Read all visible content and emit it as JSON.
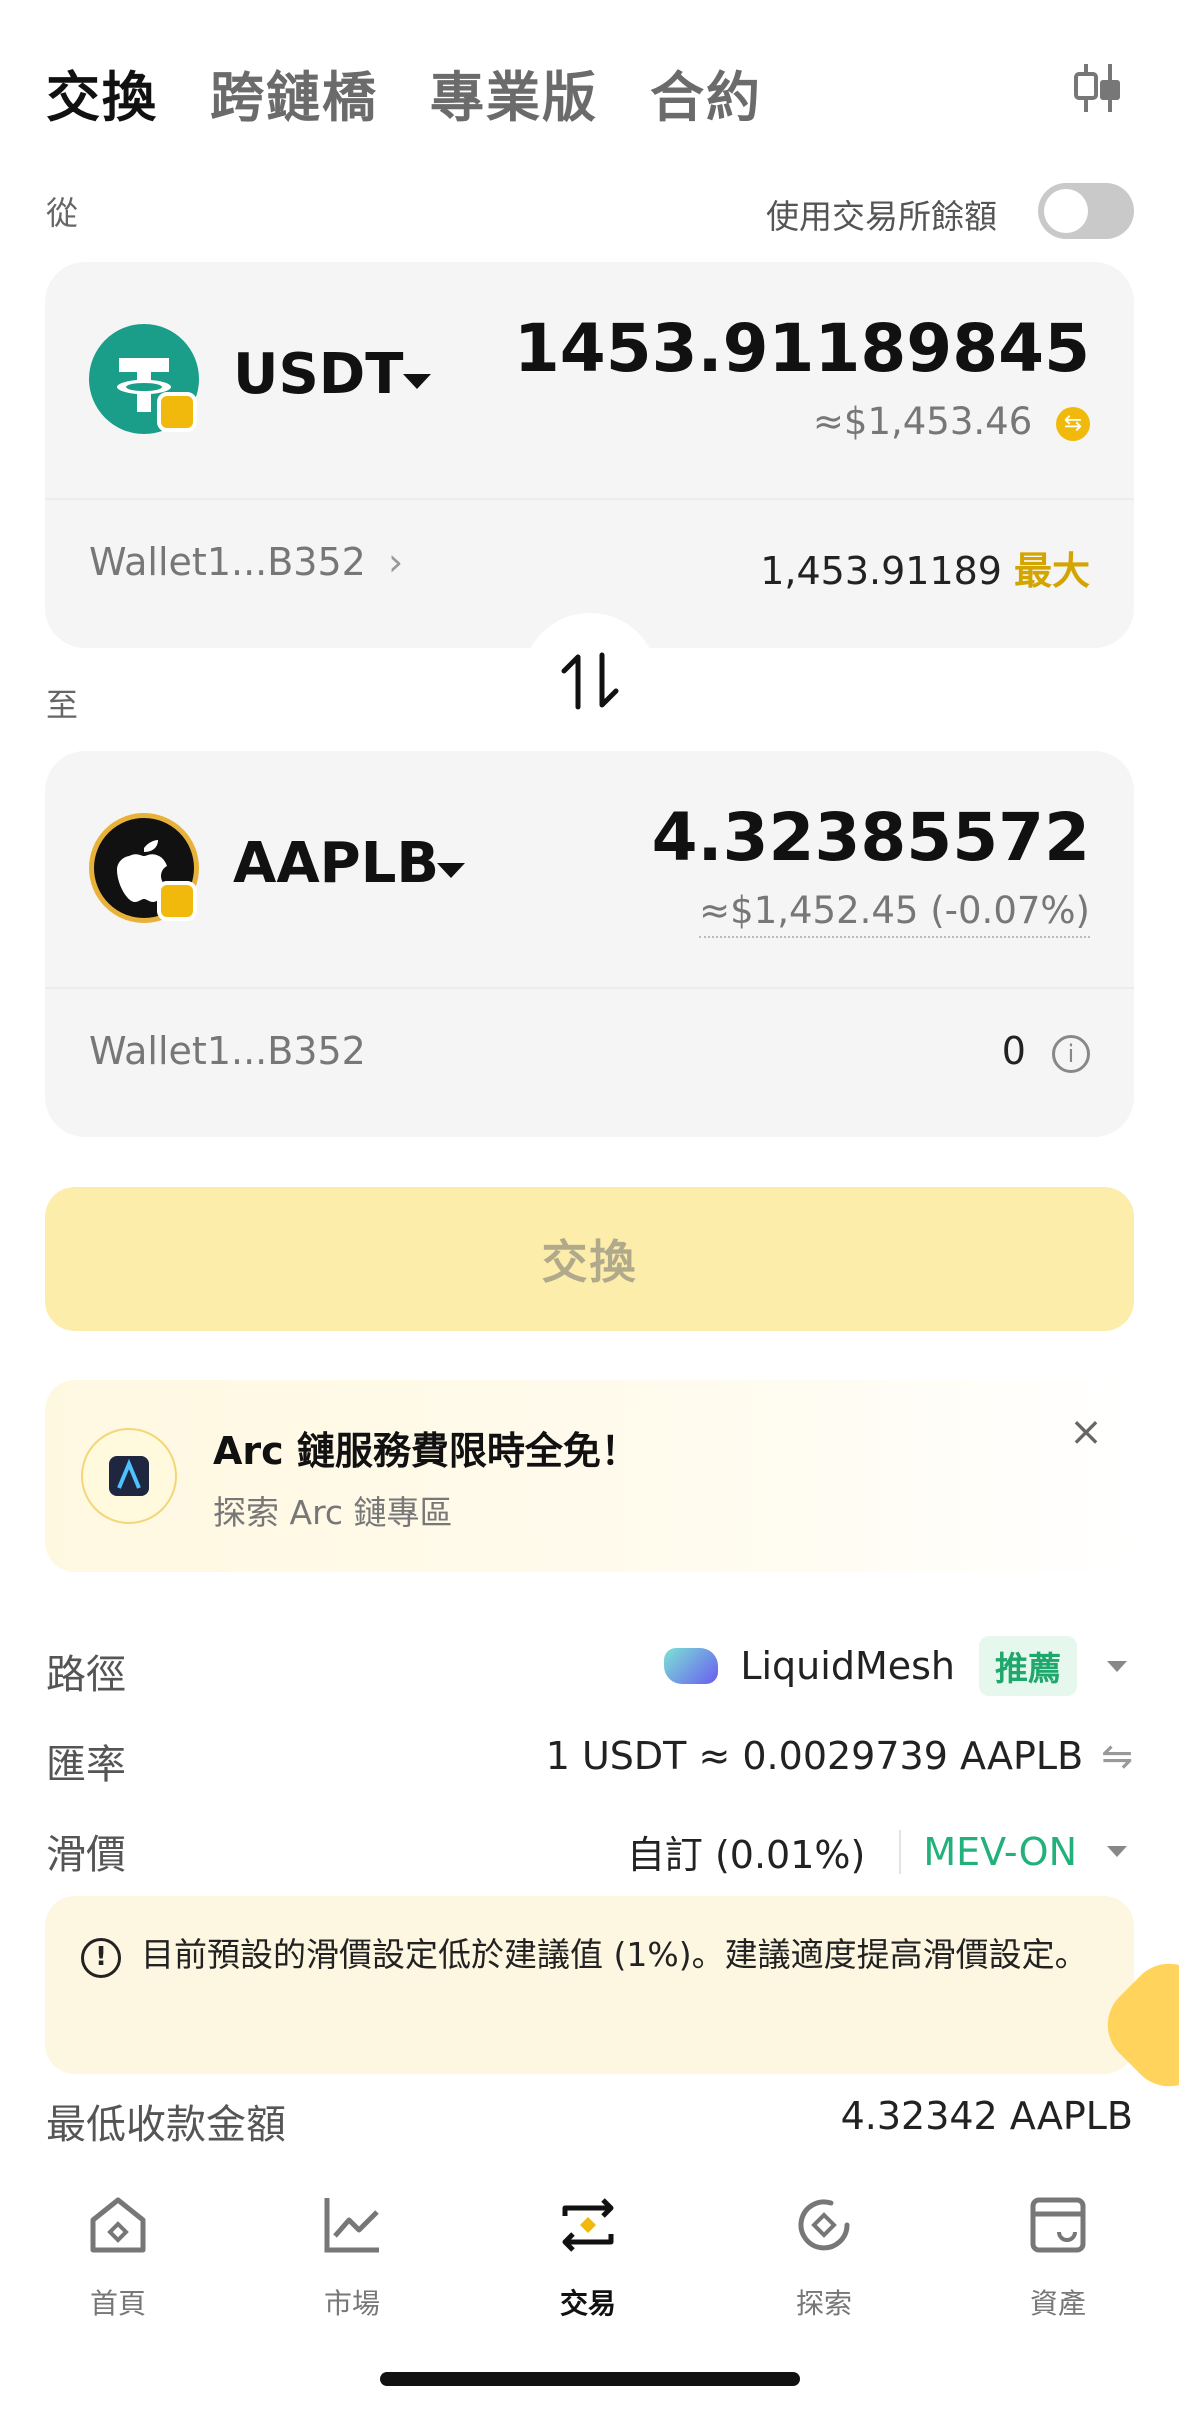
{
  "tabs": [
    {
      "label": "交換",
      "active": true
    },
    {
      "label": "跨鏈橋",
      "active": false
    },
    {
      "label": "專業版",
      "active": false
    },
    {
      "label": "合約",
      "active": false
    }
  ],
  "from": {
    "section_label": "從",
    "exchange_balance_label": "使用交易所餘額",
    "exchange_balance_enabled": false,
    "token": "USDT",
    "token_icon": "tether-icon",
    "amount": "1453.91189845",
    "usd_value": "≈$1,453.46",
    "wallet": "Wallet1...B352",
    "balance": "1,453.91189",
    "max_label": "最大"
  },
  "to": {
    "section_label": "至",
    "token": "AAPLB",
    "token_icon": "apple-icon",
    "amount": "4.32385572",
    "usd_value": "≈$1,452.45 (-0.07%)",
    "wallet": "Wallet1...B352",
    "balance": "0"
  },
  "swap_button_label": "交換",
  "promo": {
    "title": "Arc 鏈服務費限時全免！",
    "subtitle": "探索 Arc 鏈專區"
  },
  "route": {
    "label": "路徑",
    "provider": "LiquidMesh",
    "badge": "推薦"
  },
  "rate": {
    "label": "匯率",
    "value": "1 USDT ≈ 0.0029739 AAPLB"
  },
  "slippage": {
    "label": "滑價",
    "value": "自訂 (0.01%)",
    "mev": "MEV-ON"
  },
  "warning": "目前預設的滑價設定低於建議值 (1%)。建議適度提高滑價設定。",
  "min_receive": {
    "label": "最低收款金額",
    "value": "4.32342 AAPLB"
  },
  "nav": [
    {
      "label": "首頁",
      "icon": "home-icon",
      "active": false
    },
    {
      "label": "市場",
      "icon": "market-chart-icon",
      "active": false
    },
    {
      "label": "交易",
      "icon": "trade-swap-icon",
      "active": true
    },
    {
      "label": "探索",
      "icon": "explore-icon",
      "active": false
    },
    {
      "label": "資產",
      "icon": "assets-wallet-icon",
      "active": false
    }
  ],
  "colors": {
    "accent_yellow": "#f0b90b",
    "max_gold": "#d4a500",
    "green": "#1fa86b",
    "swap_button_bg": "#fcedaa",
    "card_bg": "#f5f5f5"
  }
}
